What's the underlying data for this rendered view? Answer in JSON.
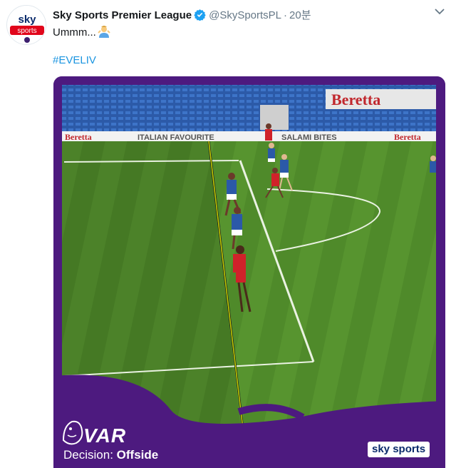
{
  "account": {
    "display_name": "Sky Sports Premier League",
    "handle": "@SkySportsPL",
    "separator": "·",
    "time": "20분",
    "avatar_top_text": "sky",
    "avatar_band_text": "sports"
  },
  "tweet": {
    "text": "Ummm...",
    "emoji": "man-shrugging-emoji",
    "hashtag": "#EVELIV"
  },
  "media": {
    "boards": [
      "Beretta",
      "ITALIAN FAVOURITE",
      "SALAMI BITES",
      "Beretta",
      "Beretta"
    ],
    "var_label": "VAR",
    "decision_prefix": "Decision:",
    "decision_value": "Offside",
    "sky_sports_logo": "sky sports"
  },
  "colors": {
    "brand_purple": "#4d1a7f",
    "link_blue": "#1b95e0",
    "pitch_green": "#4f8a2a",
    "offside_line": "#c8d400"
  }
}
